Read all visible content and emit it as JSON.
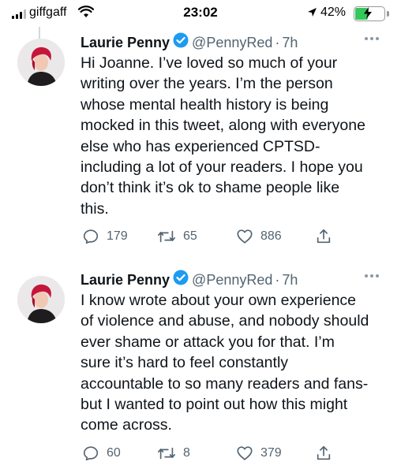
{
  "status_bar": {
    "carrier": "giffgaff",
    "time": "23:02",
    "battery": "42%",
    "battery_level": 0.42
  },
  "tweets": [
    {
      "author": "Laurie Penny",
      "handle": "@PennyRed",
      "separator": "·",
      "time": "7h",
      "text": "Hi Joanne. I’ve loved so much of your\nwriting over the years. I’m the person\nwhose mental health history is being\nmocked in this tweet, along with everyone\nelse who has experienced CPTSD-\nincluding a lot of your readers. I hope you\ndon’t think it’s ok to shame people like\nthis.",
      "replies": "179",
      "retweets": "65",
      "likes": "886"
    },
    {
      "author": "Laurie Penny",
      "handle": "@PennyRed",
      "separator": "·",
      "time": "7h",
      "text": "I know wrote about your own experience\nof violence and abuse, and nobody should\never shame or attack you for that. I’m\nsure it’s hard to feel constantly\naccountable to so many readers and fans-\nbut I wanted to point out how this might\ncome across.",
      "replies": "60",
      "retweets": "8",
      "likes": "379"
    }
  ],
  "icons": {
    "reply": "reply-icon",
    "retweet": "retweet-icon",
    "like": "like-icon",
    "share": "share-icon",
    "verified": "verified-badge-icon",
    "more": "more-options-icon"
  },
  "colors": {
    "text": "#0f1419",
    "secondary": "#536471",
    "verified": "#1d9bf0",
    "battery": "#34c759"
  }
}
